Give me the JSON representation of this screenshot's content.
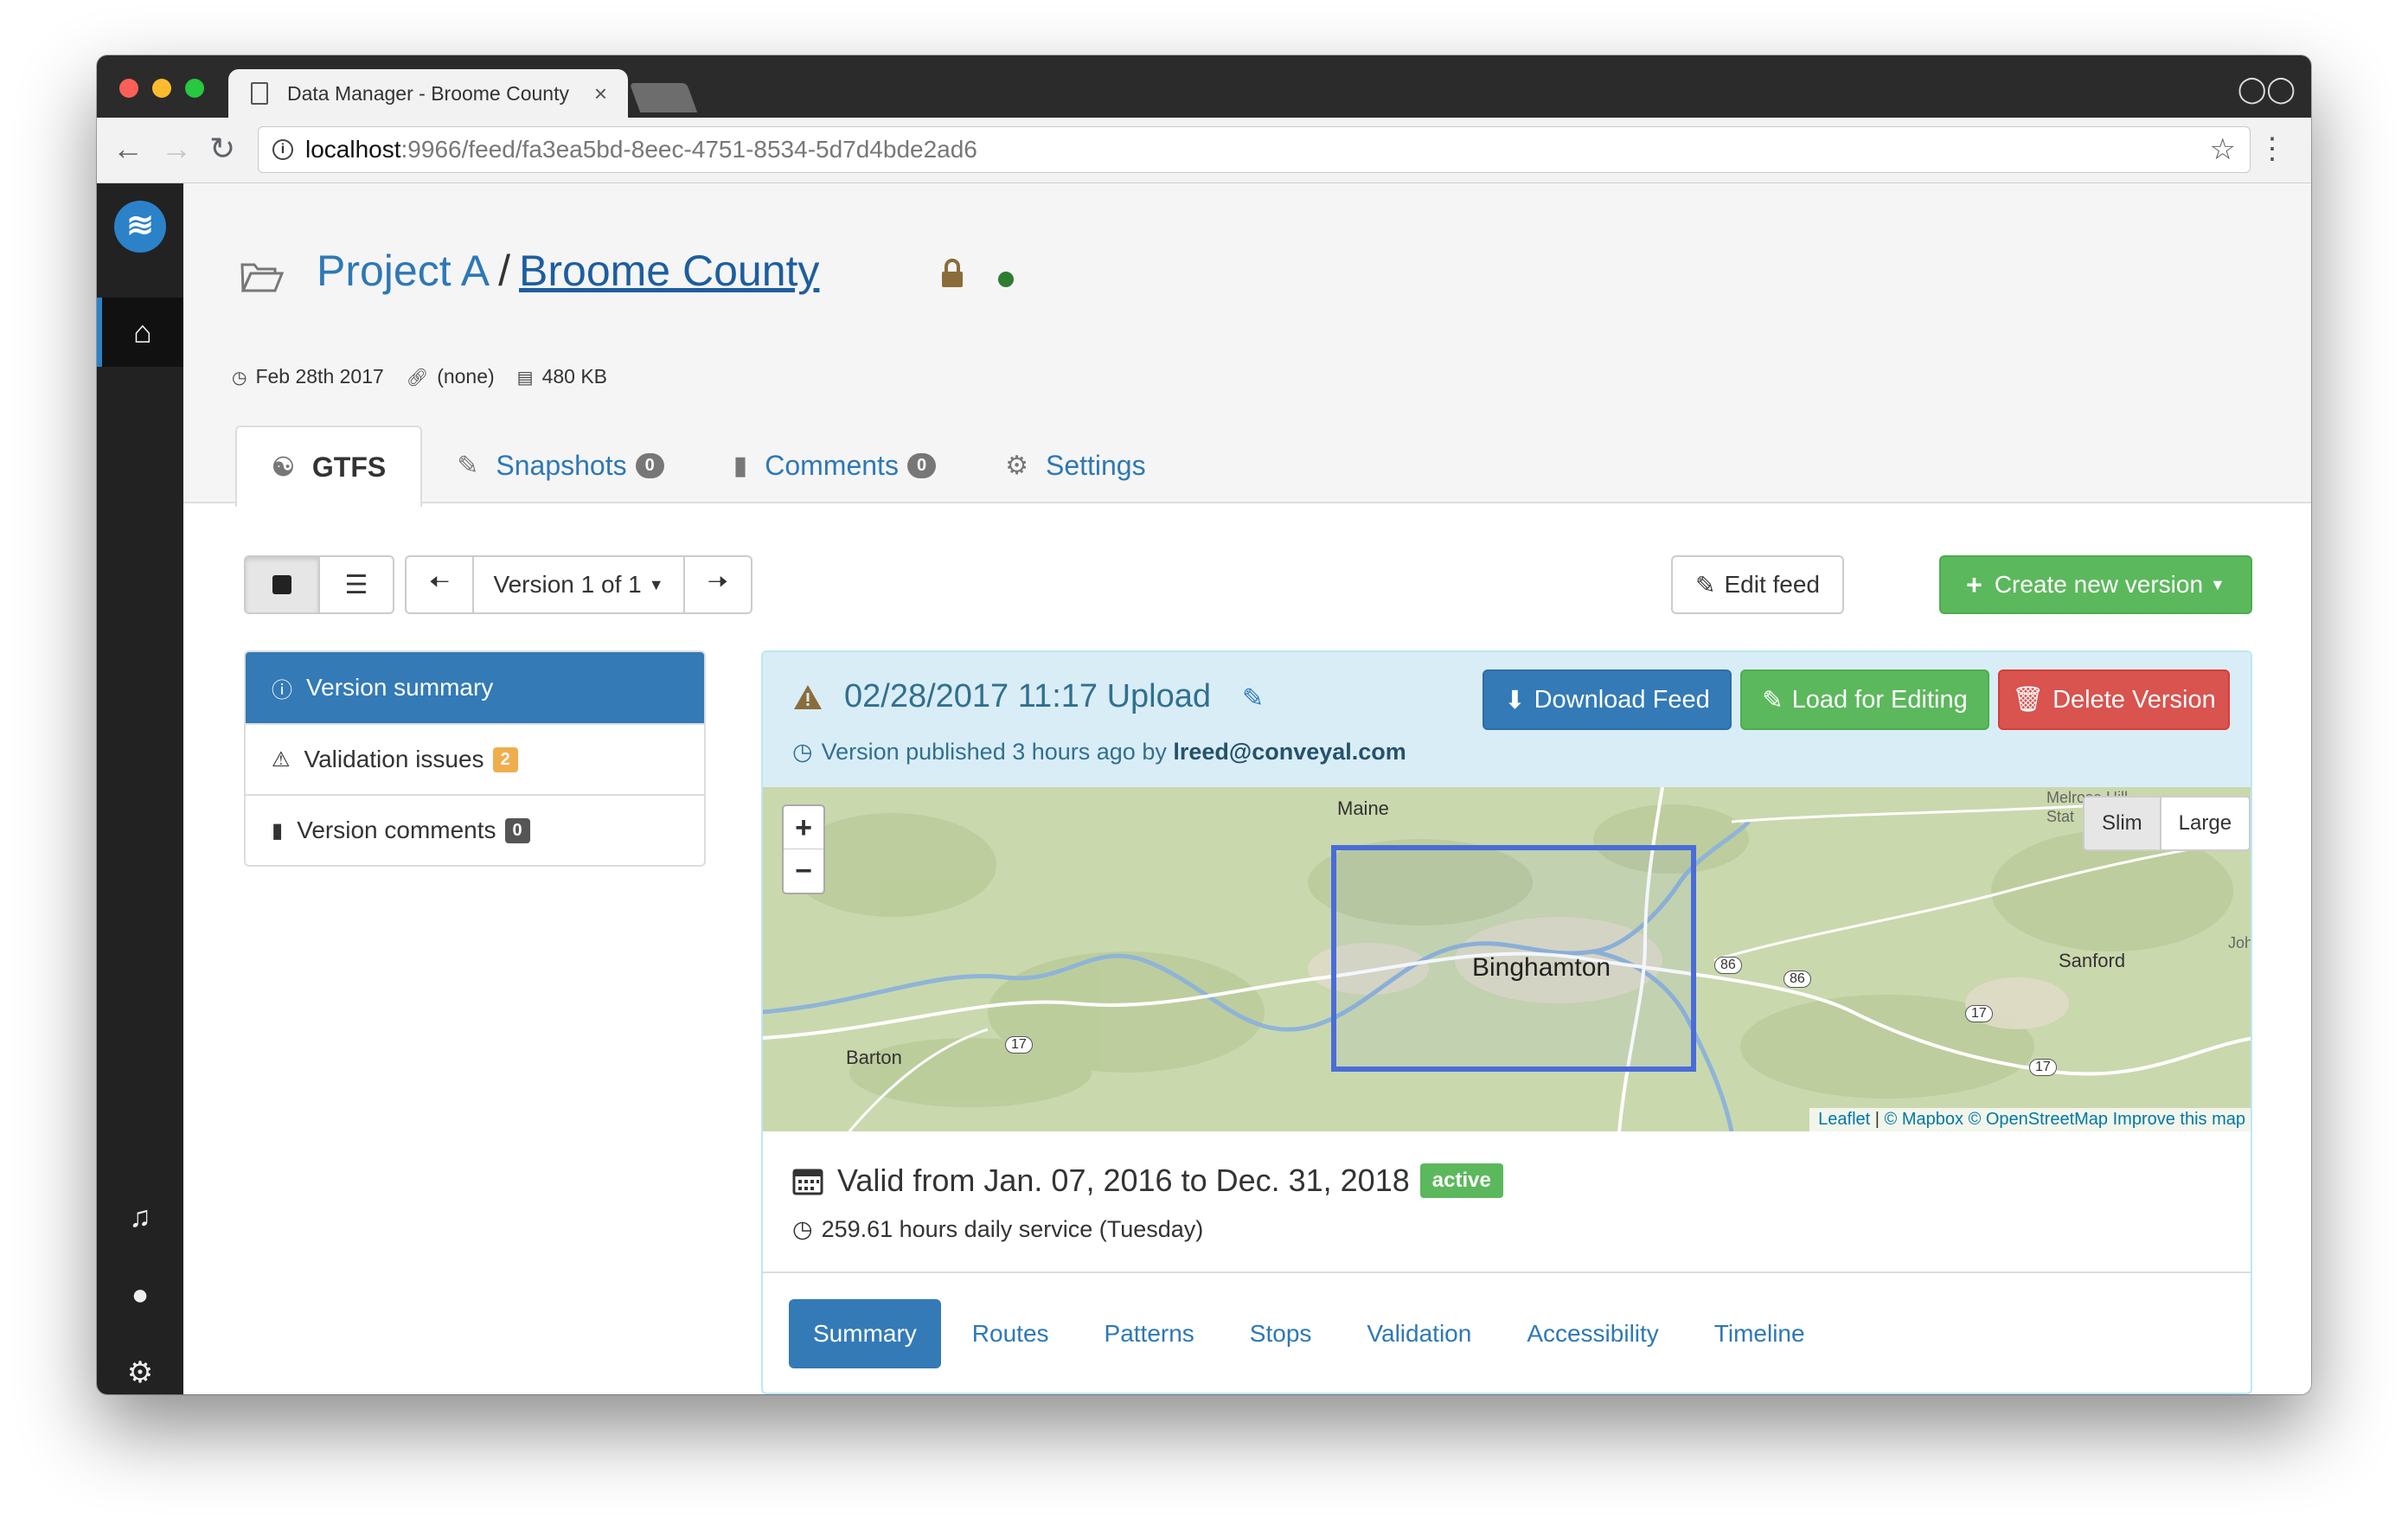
{
  "browser": {
    "tab_title": "Data Manager - Broome County",
    "tab_close": "×",
    "url_host": "localhost",
    "url_path": ":9966/feed/fa3ea5bd-8eec-4751-8534-5d7d4bde2ad6"
  },
  "project": {
    "name": "Project A",
    "separator": "/",
    "feed_name": "Broome County",
    "date": "Feb 28th 2017",
    "link": "(none)",
    "size": "480 KB"
  },
  "tabs": [
    {
      "label": "GTFS"
    },
    {
      "label": "Snapshots",
      "count": "0"
    },
    {
      "label": "Comments",
      "count": "0"
    },
    {
      "label": "Settings"
    }
  ],
  "toolbar": {
    "version_label": "Version 1 of 1",
    "edit_feed": "Edit feed",
    "create_version": "Create new version"
  },
  "side_nav": [
    {
      "label": "Version summary"
    },
    {
      "label": "Validation issues",
      "count": "2"
    },
    {
      "label": "Version comments",
      "count": "0"
    }
  ],
  "version": {
    "title": "02/28/2017 11:17 Upload",
    "published_prefix": "Version published 3 hours ago by ",
    "published_by": "lreed@conveyal.com",
    "download": "Download Feed",
    "load": "Load for Editing",
    "delete": "Delete Version",
    "valid_range": "Valid from Jan. 07, 2016 to Dec. 31, 2018",
    "status": "active",
    "hours": "259.61 hours daily service (Tuesday)"
  },
  "map": {
    "zoom_in": "+",
    "zoom_out": "−",
    "toggle_slim": "Slim",
    "toggle_large": "Large",
    "labels": {
      "maine": "Maine",
      "binghamton": "Binghamton",
      "barton": "Barton",
      "sanford": "Sanford",
      "melrose": "Melrose Hill",
      "station": "Stat",
      "joh": "Joh",
      "route17a": "17",
      "route17b": "17",
      "route17c": "17",
      "route86a": "86",
      "route86b": "86"
    },
    "attribution": {
      "leaflet": "Leaflet",
      "sep": " | ",
      "mapbox": "© Mapbox",
      "osm": "© OpenStreetMap",
      "improve": "Improve this map"
    }
  },
  "detail_tabs": [
    "Summary",
    "Routes",
    "Patterns",
    "Stops",
    "Validation",
    "Accessibility",
    "Timeline"
  ],
  "colors": {
    "primary": "#337ab7",
    "success": "#5cb85c",
    "danger": "#d9534f",
    "warning": "#f0ad4e",
    "info_bg": "#d9edf7"
  }
}
